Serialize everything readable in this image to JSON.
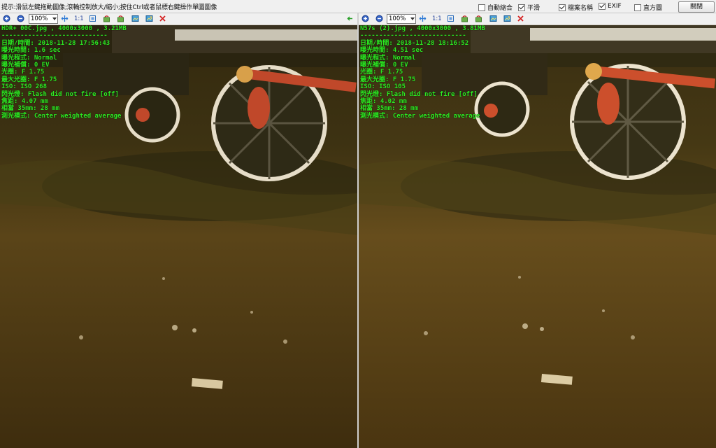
{
  "top_bar": {
    "hint": "提示:滑鼠左鍵拖動圖像;滾輪控制放大/縮小;按住Ctrl或者鼠標右鍵操作單圖圖像",
    "options": [
      {
        "label": "自動縮合",
        "checked": false
      },
      {
        "label": "平滑",
        "checked": true
      },
      {
        "label": "檔案名稱",
        "checked": true
      },
      {
        "label": "EXIF",
        "checked": true
      },
      {
        "label": "直方圖",
        "checked": false
      }
    ],
    "close_label": "關閉"
  },
  "panes": [
    {
      "zoom": "100%",
      "ratio_label": "1:1",
      "exif": [
        "HDR+ 00C.jpg , 4000x3000 , 3.21MB",
        "----------------------------",
        "日期/時間: 2018-11-28 17:56:43",
        "曝光時間: 1.6 sec",
        "曝光程式: Normal",
        "曝光補償: 0 EV",
        "光圈: F 1.75",
        "最大光圈: F 1.75",
        "ISO: ISO 268",
        "閃光燈: Flash did not fire [off]",
        "焦距: 4.07 mm",
        "相當 35mm: 28 mm",
        "測光模式: Center weighted average"
      ]
    },
    {
      "zoom": "100%",
      "ratio_label": "1:1",
      "exif": [
        "N57s (2).jpg , 4000x3000 , 3.81MB",
        "----------------------------",
        "日期/時間: 2018-11-28 18:16:52",
        "曝光時間: 4.51 sec",
        "曝光程式: Normal",
        "曝光補償: 0 EV",
        "光圈: F 1.75",
        "最大光圈: F 1.75",
        "ISO: ISO 105",
        "閃光燈: Flash did not fire [off]",
        "焦距: 4.02 mm",
        "相當 35mm: 28 mm",
        "測光模式: Center weighted average"
      ]
    }
  ],
  "colors": {
    "exif_text": "#2dea22",
    "ground_top": "#4a3a14",
    "ground_bottom": "#3a2a0c",
    "rod_red": "#c0482a",
    "wheel_white": "#e8e0d0"
  }
}
